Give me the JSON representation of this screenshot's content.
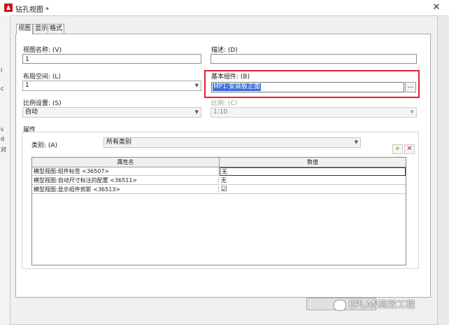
{
  "window": {
    "title": "钻孔视图 *",
    "close_glyph": "✕"
  },
  "left_strip_chars": [
    "l",
    "c",
    "s",
    "d",
    "对"
  ],
  "tabs": [
    {
      "label": "视图"
    },
    {
      "label": "显示"
    },
    {
      "label": "格式"
    }
  ],
  "form": {
    "view_name_label": "视图名称: (V)",
    "view_name_value": "1",
    "description_label": "描述: (D)",
    "description_value": "",
    "layout_space_label": "布局空间: (L)",
    "layout_space_value": "1",
    "base_component_label": "基本组件: (B)",
    "base_component_value": "MP1:安装板正面",
    "browse_label": "...",
    "scale_setting_label": "比例设置: (S)",
    "scale_setting_value": "自动",
    "scale_label": "比例: (C)",
    "scale_value": "1:10"
  },
  "properties": {
    "group_label": "属性",
    "category_label": "类别: (A)",
    "category_value": "所有类别",
    "add_glyph": "+",
    "delete_glyph": "✕",
    "columns": [
      "属性名",
      "数值"
    ],
    "rows": [
      {
        "name": "模型视图:组件标签 <36507>",
        "value": "无"
      },
      {
        "name": "模型视图:自动尺寸标注的配置 <36511>",
        "value": "无"
      },
      {
        "name": "模型视图:显示组件剪影 <36513>",
        "value": "☑"
      }
    ]
  },
  "watermark": "EPLAN高效工程"
}
